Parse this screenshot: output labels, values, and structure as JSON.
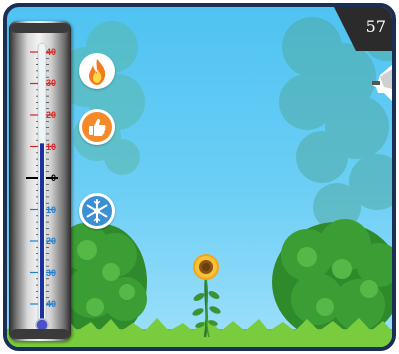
{
  "score": "57",
  "thermometer": {
    "hot_labels": [
      "40",
      "30",
      "20",
      "10"
    ],
    "zero_label": "0",
    "cold_labels": [
      "10",
      "20",
      "30",
      "40"
    ],
    "reading": 11
  },
  "buttons": [
    {
      "name": "heat-button",
      "icon": "flame-icon"
    },
    {
      "name": "good-button",
      "icon": "thumbs-up-icon"
    },
    {
      "name": "cold-button",
      "icon": "snowflake-icon"
    }
  ],
  "colors": {
    "sky": "#6dcff5",
    "mercury": "#1e2f9e",
    "hot_scale": "#d42a2a",
    "cold_scale": "#1e7fd0",
    "frame": "#1b2f55",
    "grass": "#6cc234"
  }
}
